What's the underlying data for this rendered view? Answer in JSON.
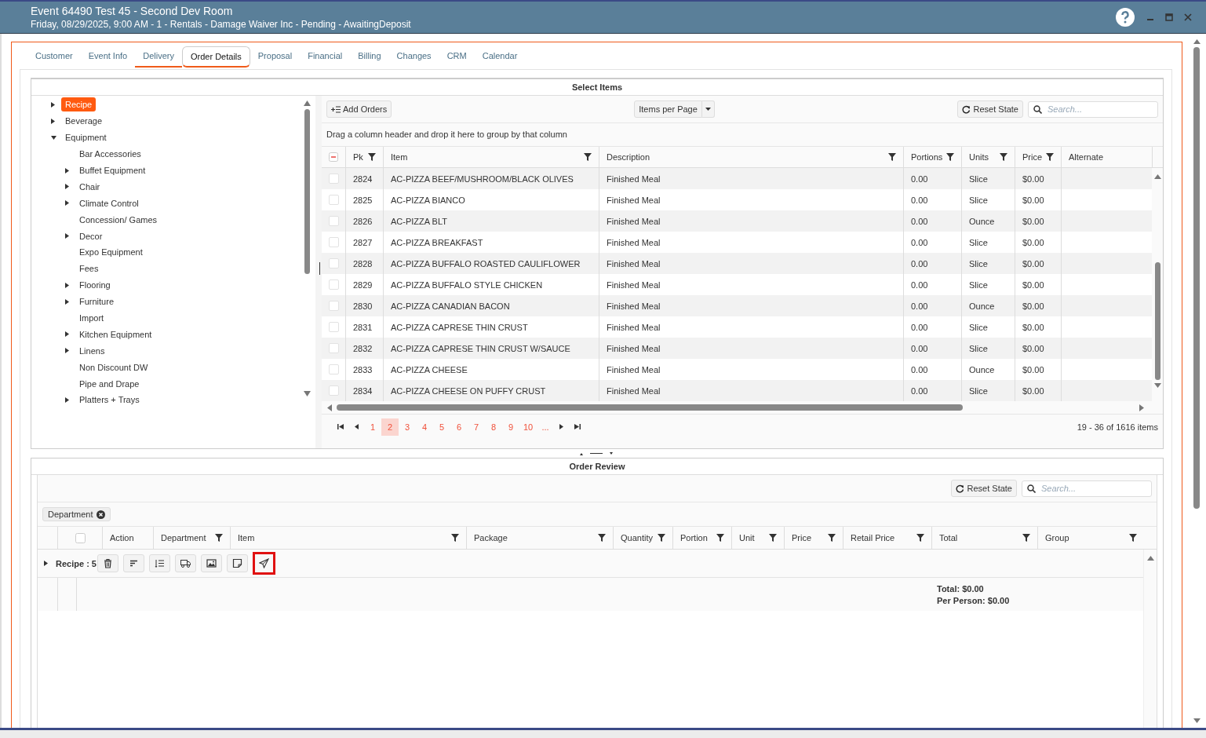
{
  "window": {
    "title": "Event 64490 Test 45 - Second Dev Room",
    "subtitle": "Friday, 08/29/2025, 9:00 AM - 1 - Rentals - Damage Waiver Inc - Pending - AwaitingDeposit"
  },
  "tabs": [
    {
      "label": "Customer",
      "selected": false,
      "underlined": false
    },
    {
      "label": "Event Info",
      "selected": false,
      "underlined": false
    },
    {
      "label": "Delivery",
      "selected": false,
      "underlined": true
    },
    {
      "label": "Order Details",
      "selected": true,
      "underlined": true
    },
    {
      "label": "Proposal",
      "selected": false,
      "underlined": false
    },
    {
      "label": "Financial",
      "selected": false,
      "underlined": false
    },
    {
      "label": "Billing",
      "selected": false,
      "underlined": false
    },
    {
      "label": "Changes",
      "selected": false,
      "underlined": false
    },
    {
      "label": "CRM",
      "selected": false,
      "underlined": false
    },
    {
      "label": "Calendar",
      "selected": false,
      "underlined": false
    }
  ],
  "select_items": {
    "title": "Select Items",
    "tree": [
      {
        "label": "Recipe",
        "expandable": true,
        "expanded": false,
        "selected": true
      },
      {
        "label": "Beverage",
        "expandable": true,
        "expanded": false,
        "selected": false
      },
      {
        "label": "Equipment",
        "expandable": true,
        "expanded": true,
        "selected": false,
        "children": [
          {
            "label": "Bar Accessories",
            "expandable": false,
            "selected": false
          },
          {
            "label": "Buffet Equipment",
            "expandable": true,
            "expanded": false,
            "selected": false
          },
          {
            "label": "Chair",
            "expandable": true,
            "expanded": false,
            "selected": false
          },
          {
            "label": "Climate Control",
            "expandable": true,
            "expanded": false,
            "selected": false
          },
          {
            "label": "Concession/ Games",
            "expandable": false,
            "selected": false
          },
          {
            "label": "Decor",
            "expandable": true,
            "expanded": false,
            "selected": false
          },
          {
            "label": "Expo Equipment",
            "expandable": false,
            "selected": false
          },
          {
            "label": "Fees",
            "expandable": false,
            "selected": false
          },
          {
            "label": "Flooring",
            "expandable": true,
            "expanded": false,
            "selected": false
          },
          {
            "label": "Furniture",
            "expandable": true,
            "expanded": false,
            "selected": false
          },
          {
            "label": "Import",
            "expandable": false,
            "selected": false
          },
          {
            "label": "Kitchen Equipment",
            "expandable": true,
            "expanded": false,
            "selected": false
          },
          {
            "label": "Linens",
            "expandable": true,
            "expanded": false,
            "selected": false
          },
          {
            "label": "Non Discount DW",
            "expandable": false,
            "selected": false
          },
          {
            "label": "Pipe and Drape",
            "expandable": false,
            "selected": false
          },
          {
            "label": "Platters + Trays",
            "expandable": true,
            "expanded": false,
            "selected": false
          }
        ]
      }
    ],
    "add_orders": "Add Orders",
    "items_per_page": "Items per Page",
    "reset_state": "Reset State",
    "search_placeholder": "Search...",
    "group_hint": "Drag a column header and drop it here to group by that column",
    "header_checked": false,
    "header_indeterminate": true,
    "columns": [
      {
        "label": "Pk",
        "filter": true
      },
      {
        "label": "Item",
        "filter": true
      },
      {
        "label": "Description",
        "filter": true
      },
      {
        "label": "Portions",
        "filter": true
      },
      {
        "label": "Units",
        "filter": true
      },
      {
        "label": "Price",
        "filter": true
      },
      {
        "label": "Alternate",
        "filter": false
      }
    ],
    "rows": [
      {
        "checked": false,
        "cells": [
          "2824",
          "AC-PIZZA BEEF/MUSHROOM/BLACK OLIVES",
          "Finished Meal",
          "0.00",
          "Slice",
          "$0.00"
        ]
      },
      {
        "checked": false,
        "cells": [
          "2825",
          "AC-PIZZA BIANCO",
          "Finished Meal",
          "0.00",
          "Slice",
          "$0.00"
        ]
      },
      {
        "checked": false,
        "cells": [
          "2826",
          "AC-PIZZA BLT",
          "Finished Meal",
          "0.00",
          "Ounce",
          "$0.00"
        ]
      },
      {
        "checked": false,
        "cells": [
          "2827",
          "AC-PIZZA BREAKFAST",
          "Finished Meal",
          "0.00",
          "Slice",
          "$0.00"
        ]
      },
      {
        "checked": false,
        "cells": [
          "2828",
          "AC-PIZZA BUFFALO ROASTED CAULIFLOWER",
          "Finished Meal",
          "0.00",
          "Slice",
          "$0.00"
        ]
      },
      {
        "checked": false,
        "cells": [
          "2829",
          "AC-PIZZA BUFFALO STYLE CHICKEN",
          "Finished Meal",
          "0.00",
          "Slice",
          "$0.00"
        ]
      },
      {
        "checked": false,
        "cells": [
          "2830",
          "AC-PIZZA CANADIAN BACON",
          "Finished Meal",
          "0.00",
          "Ounce",
          "$0.00"
        ]
      },
      {
        "checked": false,
        "cells": [
          "2831",
          "AC-PIZZA CAPRESE THIN CRUST",
          "Finished Meal",
          "0.00",
          "Slice",
          "$0.00"
        ]
      },
      {
        "checked": false,
        "cells": [
          "2832",
          "AC-PIZZA CAPRESE THIN CRUST W/SAUCE",
          "Finished Meal",
          "0.00",
          "Slice",
          "$0.00"
        ]
      },
      {
        "checked": false,
        "cells": [
          "2833",
          "AC-PIZZA CHEESE",
          "Finished Meal",
          "0.00",
          "Ounce",
          "$0.00"
        ]
      },
      {
        "checked": false,
        "cells": [
          "2834",
          "AC-PIZZA CHEESE ON PUFFY CRUST",
          "Finished Meal",
          "0.00",
          "Slice",
          "$0.00"
        ]
      }
    ],
    "pages": [
      {
        "label": "1",
        "selected": false
      },
      {
        "label": "2",
        "selected": true
      },
      {
        "label": "3",
        "selected": false
      },
      {
        "label": "4",
        "selected": false
      },
      {
        "label": "5",
        "selected": false
      },
      {
        "label": "6",
        "selected": false
      },
      {
        "label": "7",
        "selected": false
      },
      {
        "label": "8",
        "selected": false
      },
      {
        "label": "9",
        "selected": false
      },
      {
        "label": "10",
        "selected": false
      },
      {
        "label": "...",
        "selected": false
      }
    ],
    "pager_info": "19 - 36 of 1616 items"
  },
  "order_review": {
    "title": "Order Review",
    "reset_state": "Reset State",
    "search_placeholder": "Search...",
    "group_chip": "Department",
    "header_checked": false,
    "columns": [
      {
        "label": "Action",
        "filter": false
      },
      {
        "label": "Department",
        "filter": true
      },
      {
        "label": "Item",
        "filter": true
      },
      {
        "label": "Package",
        "filter": true
      },
      {
        "label": "Quantity",
        "filter": true
      },
      {
        "label": "Portion",
        "filter": true
      },
      {
        "label": "Unit",
        "filter": true
      },
      {
        "label": "Price",
        "filter": true
      },
      {
        "label": "Retail Price",
        "filter": true
      },
      {
        "label": "Total",
        "filter": true
      },
      {
        "label": "Group",
        "filter": true
      }
    ],
    "group_row": {
      "label": "Recipe : 5",
      "actions": [
        {
          "kind": "trash",
          "highlighted": false
        },
        {
          "kind": "sort",
          "highlighted": false
        },
        {
          "kind": "list",
          "highlighted": false
        },
        {
          "kind": "truck",
          "highlighted": false
        },
        {
          "kind": "image",
          "highlighted": false
        },
        {
          "kind": "note",
          "highlighted": false
        },
        {
          "kind": "send",
          "highlighted": true
        }
      ]
    },
    "totals": [
      "Total: $0.00",
      "Per Person: $0.00"
    ]
  }
}
